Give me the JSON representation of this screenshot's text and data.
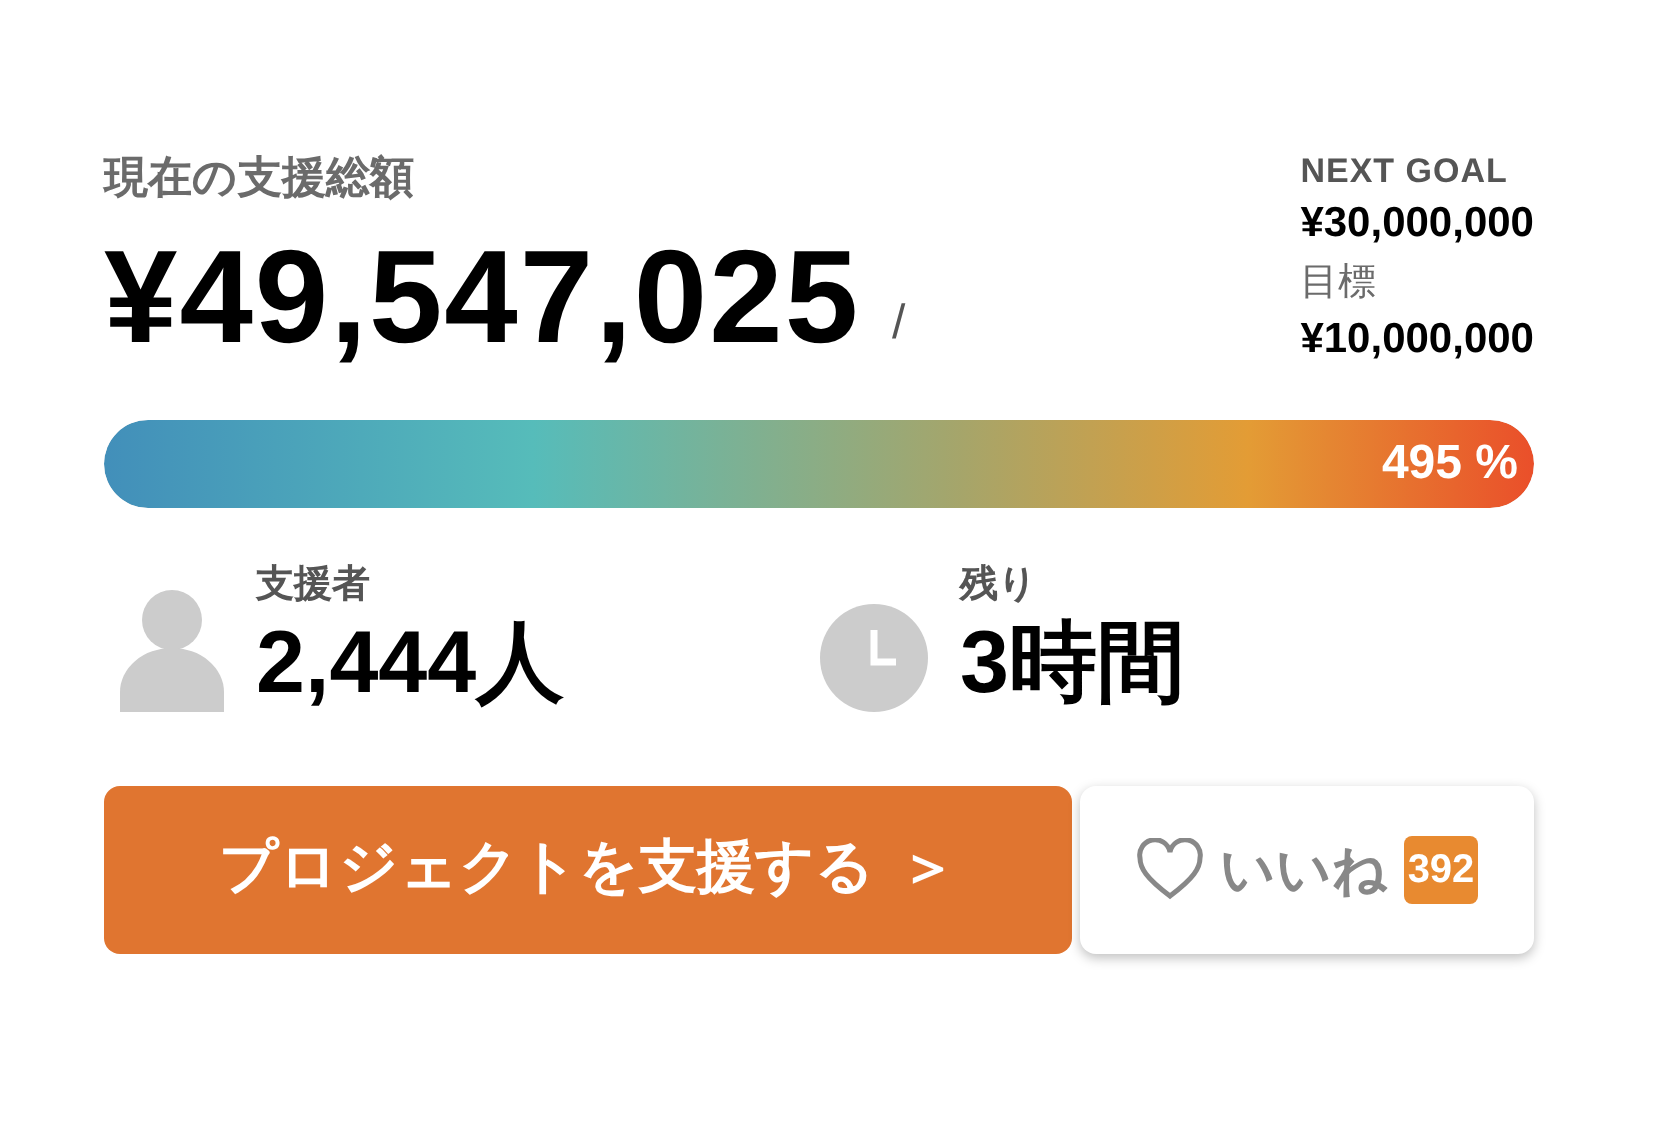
{
  "funding": {
    "label": "現在の支援総額",
    "amount": "¥49,547,025",
    "separator": "/"
  },
  "goals": [
    {
      "label": "NEXT GOAL",
      "amount": "¥30,000,000",
      "kind": "next"
    },
    {
      "label": "目標",
      "amount": "¥10,000,000",
      "kind": "base"
    }
  ],
  "progress": {
    "level": 1,
    "reading": "495 %"
  },
  "stats": [
    {
      "kind": "backers",
      "label": "支援者",
      "value": "2,444人"
    },
    {
      "kind": "time",
      "label": "残り",
      "value": "3時間"
    }
  ],
  "support_button": {
    "label": "プロジェクトを支援する",
    "arrow": "＞"
  },
  "like_button": {
    "label": "いいね",
    "count": "392"
  }
}
